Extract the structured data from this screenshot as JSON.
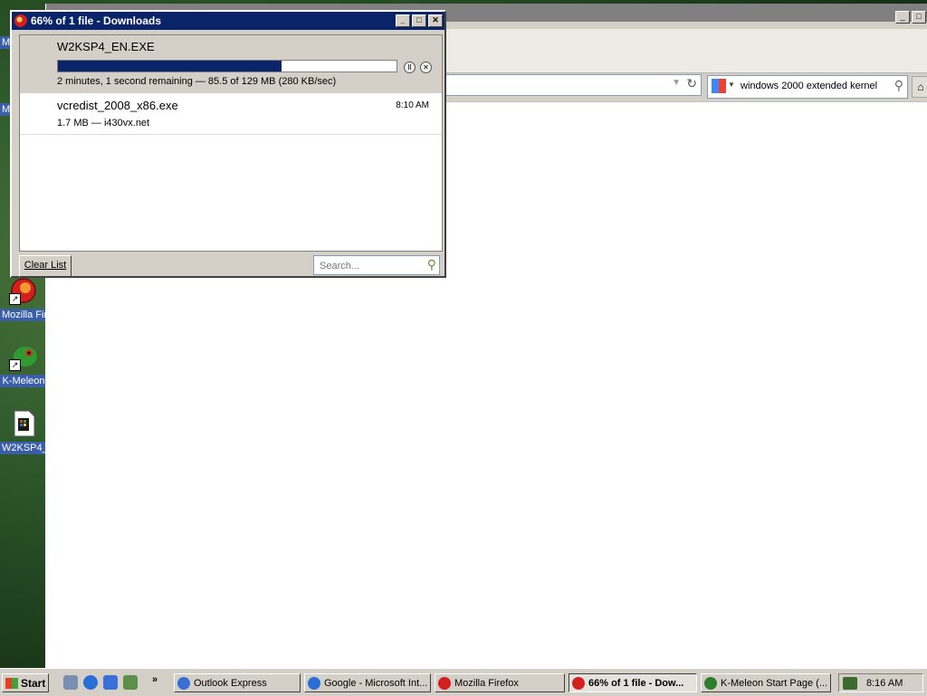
{
  "desktop": {
    "icons": [
      {
        "label": "Mozilla Fire",
        "icon": "firefox-icon"
      },
      {
        "label": "K-Meleon",
        "icon": "kmeleon-icon"
      },
      {
        "label": "W2KSP4_",
        "icon": "setup-file-icon"
      }
    ],
    "partial_labels": [
      "M",
      "M"
    ]
  },
  "browser": {
    "search_text": "windows 2000 extended kernel"
  },
  "downloads": {
    "title": "66% of 1 file - Downloads",
    "items": [
      {
        "filename": "W2KSP4_EN.EXE",
        "progress": 0.66,
        "status": "2 minutes, 1 second remaining — 85.5 of 129 MB (280 KB/sec)"
      },
      {
        "filename": "vcredist_2008_x86.exe",
        "status": "1.7 MB — i430vx.net",
        "time": "8:10 AM"
      }
    ],
    "clear_list_label": "Clear List",
    "search_placeholder": "Search..."
  },
  "taskbar": {
    "start_label": "Start",
    "more_label": "»",
    "tasks": [
      {
        "label": "Outlook Express",
        "icon": "outlook-express-icon",
        "color": "#3a6fd8"
      },
      {
        "label": "Google - Microsoft Int...",
        "icon": "ie-icon",
        "color": "#2a6fd6"
      },
      {
        "label": "Mozilla Firefox",
        "icon": "firefox-icon",
        "color": "#d3201e"
      },
      {
        "label": "66% of 1 file - Dow...",
        "icon": "firefox-icon",
        "color": "#d3201e",
        "active": true
      },
      {
        "label": "K-Meleon Start Page (...",
        "icon": "kmeleon-icon",
        "color": "#2f7d2f"
      }
    ],
    "clock": "8:16 AM"
  }
}
